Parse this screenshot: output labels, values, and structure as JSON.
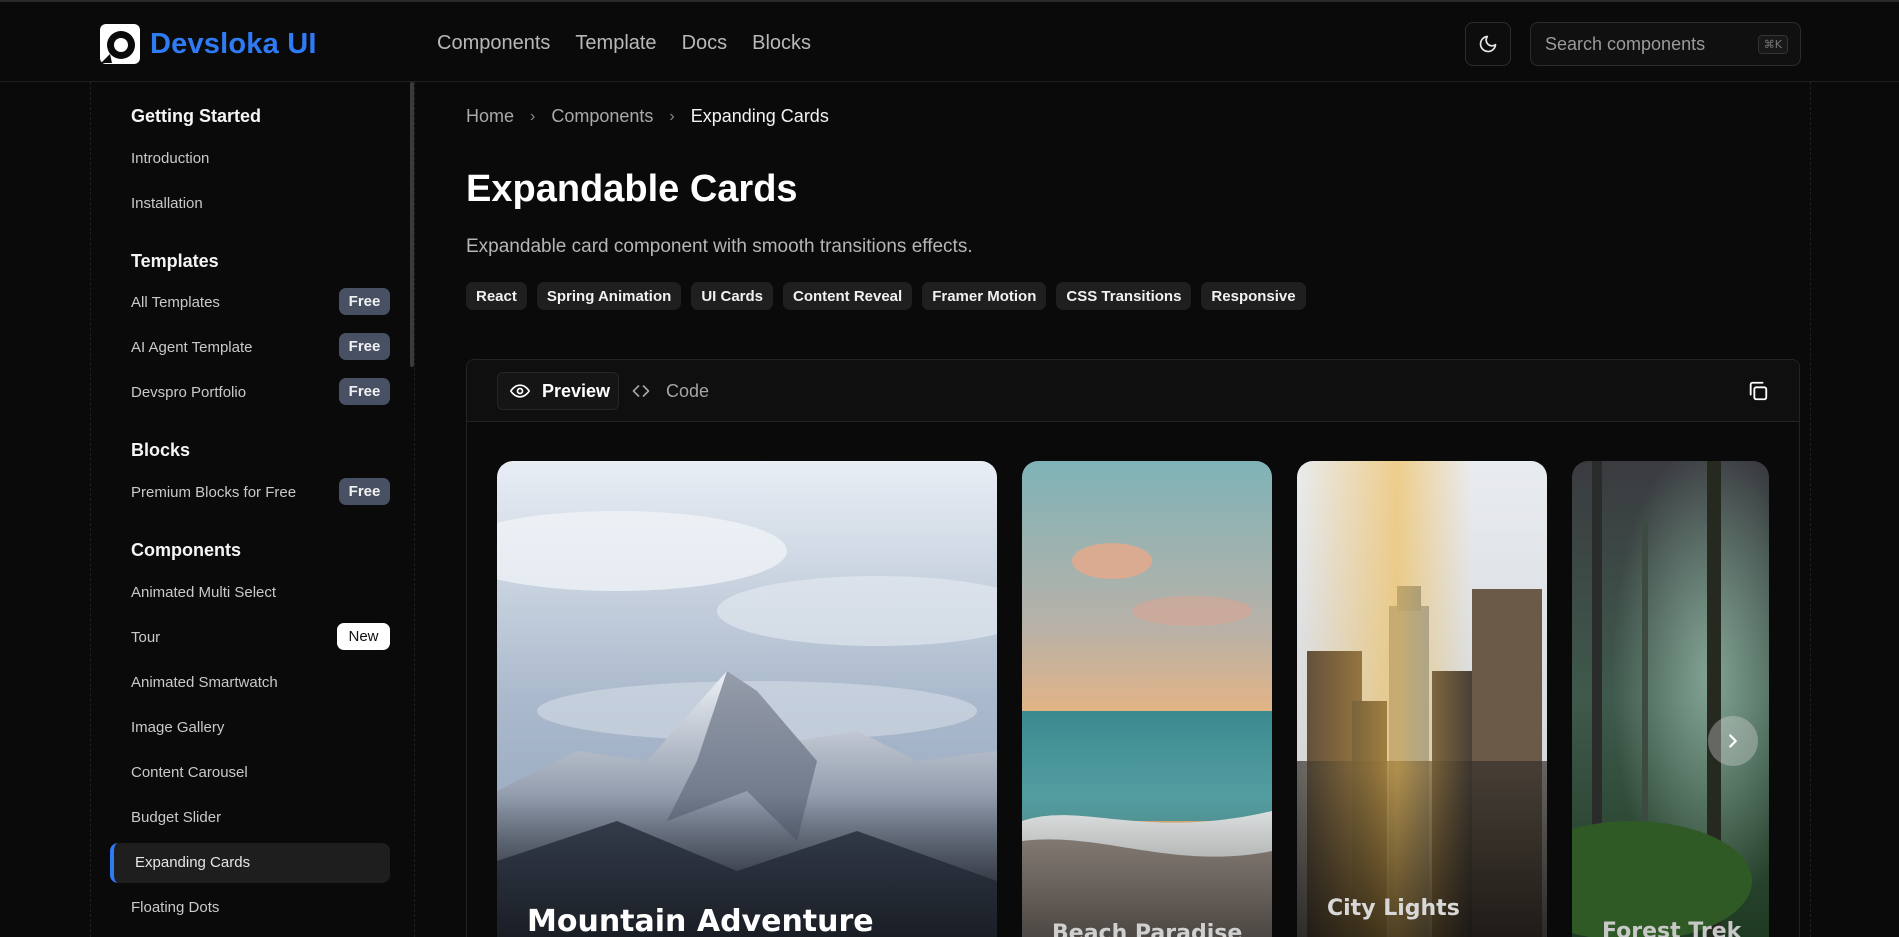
{
  "brand": {
    "name": "Devsloka UI"
  },
  "topnav": [
    "Components",
    "Template",
    "Docs",
    "Blocks"
  ],
  "search": {
    "placeholder": "Search components",
    "shortcut": "⌘K"
  },
  "sidebar": {
    "sections": [
      {
        "title": "Getting Started",
        "items": [
          {
            "label": "Introduction"
          },
          {
            "label": "Installation"
          }
        ]
      },
      {
        "title": "Templates",
        "items": [
          {
            "label": "All Templates",
            "badge": "Free"
          },
          {
            "label": "AI Agent Template",
            "badge": "Free"
          },
          {
            "label": "Devspro Portfolio",
            "badge": "Free"
          }
        ]
      },
      {
        "title": "Blocks",
        "items": [
          {
            "label": "Premium Blocks for Free",
            "badge": "Free"
          }
        ]
      },
      {
        "title": "Components",
        "items": [
          {
            "label": "Animated Multi Select"
          },
          {
            "label": "Tour",
            "badge": "New"
          },
          {
            "label": "Animated Smartwatch"
          },
          {
            "label": "Image Gallery"
          },
          {
            "label": "Content Carousel"
          },
          {
            "label": "Budget Slider"
          },
          {
            "label": "Expanding Cards",
            "active": true
          },
          {
            "label": "Floating Dots"
          }
        ]
      }
    ]
  },
  "breadcrumb": [
    "Home",
    "Components",
    "Expanding Cards"
  ],
  "page": {
    "title": "Expandable Cards",
    "description": "Expandable card component with smooth transitions effects.",
    "tags": [
      "React",
      "Spring Animation",
      "UI Cards",
      "Content Reveal",
      "Framer Motion",
      "CSS Transitions",
      "Responsive"
    ]
  },
  "panel": {
    "tabs": {
      "preview": "Preview",
      "code": "Code"
    }
  },
  "cards": [
    {
      "title": "Mountain Adventure",
      "image": "snowy-mountain-peak"
    },
    {
      "title": "Beach Paradise",
      "image": "sunset-beach"
    },
    {
      "title": "City Lights",
      "image": "city-skyscrapers"
    },
    {
      "title": "Forest Trek",
      "image": "misty-forest"
    }
  ],
  "colors": {
    "accent": "#2f7bf6",
    "background": "#0a0a0a",
    "badge": "#475163"
  }
}
